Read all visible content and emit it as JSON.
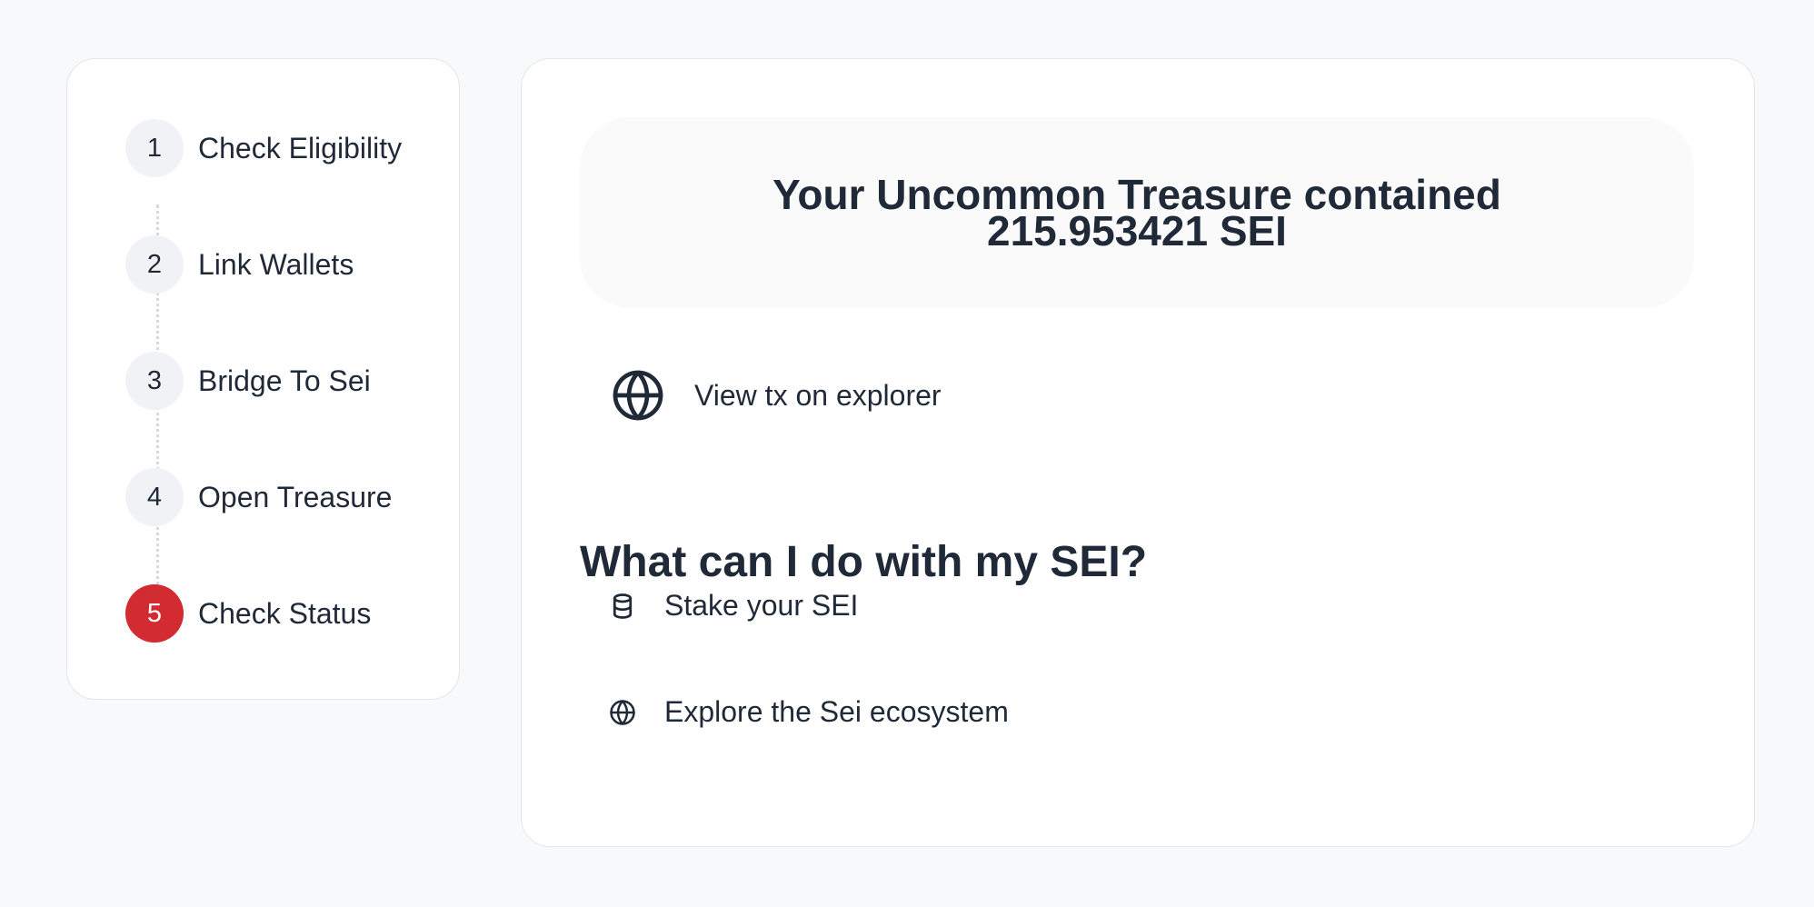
{
  "stepper": {
    "steps": [
      {
        "number": "1",
        "label": "Check Eligibility",
        "active": false
      },
      {
        "number": "2",
        "label": "Link Wallets",
        "active": false
      },
      {
        "number": "3",
        "label": "Bridge To Sei",
        "active": false
      },
      {
        "number": "4",
        "label": "Open Treasure",
        "active": false
      },
      {
        "number": "5",
        "label": "Check Status",
        "active": true
      }
    ]
  },
  "result": {
    "title_line1": "Your Uncommon Treasure contained",
    "title_line2": "215.953421 SEI"
  },
  "explorer_link": {
    "label": "View tx on explorer",
    "icon": "globe-icon"
  },
  "next_steps": {
    "heading": "What can I do with my SEI?",
    "items": [
      {
        "label": "Stake your SEI",
        "icon": "database-icon"
      },
      {
        "label": "Explore the Sei ecosystem",
        "icon": "globe-icon"
      }
    ]
  },
  "colors": {
    "accent": "#d22b31",
    "text": "#1f2937",
    "background": "#f8f9fb",
    "step_inactive": "#f1f2f5"
  }
}
